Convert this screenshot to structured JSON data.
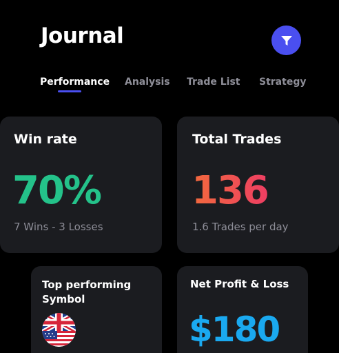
{
  "header": {
    "title": "Journal",
    "filter_icon": "filter-icon"
  },
  "tabs": [
    {
      "label": "Performance",
      "active": true
    },
    {
      "label": "Analysis",
      "active": false
    },
    {
      "label": "Trade List",
      "active": false
    },
    {
      "label": "Strategy",
      "active": false
    }
  ],
  "cards": {
    "win_rate": {
      "title": "Win rate",
      "value": "70%",
      "subtitle": "7 Wins - 3 Losses",
      "value_color": "#24c28a"
    },
    "total_trades": {
      "title": "Total Trades",
      "value": "136",
      "subtitle": "1.6 Trades per day",
      "value_gradient": [
        "#f26a3d",
        "#ee3e63"
      ]
    },
    "top_symbol": {
      "title": "Top performing Symbol",
      "icons": [
        "uk-flag-icon",
        "us-flag-icon"
      ]
    },
    "net_pnl": {
      "title": "Net Profit & Loss",
      "value": "$180",
      "value_color": "#1aa9f0"
    }
  },
  "colors": {
    "accent": "#4a4ff0",
    "background": "#000000",
    "card": "#1b1c20",
    "muted_text": "#8e8e98"
  }
}
